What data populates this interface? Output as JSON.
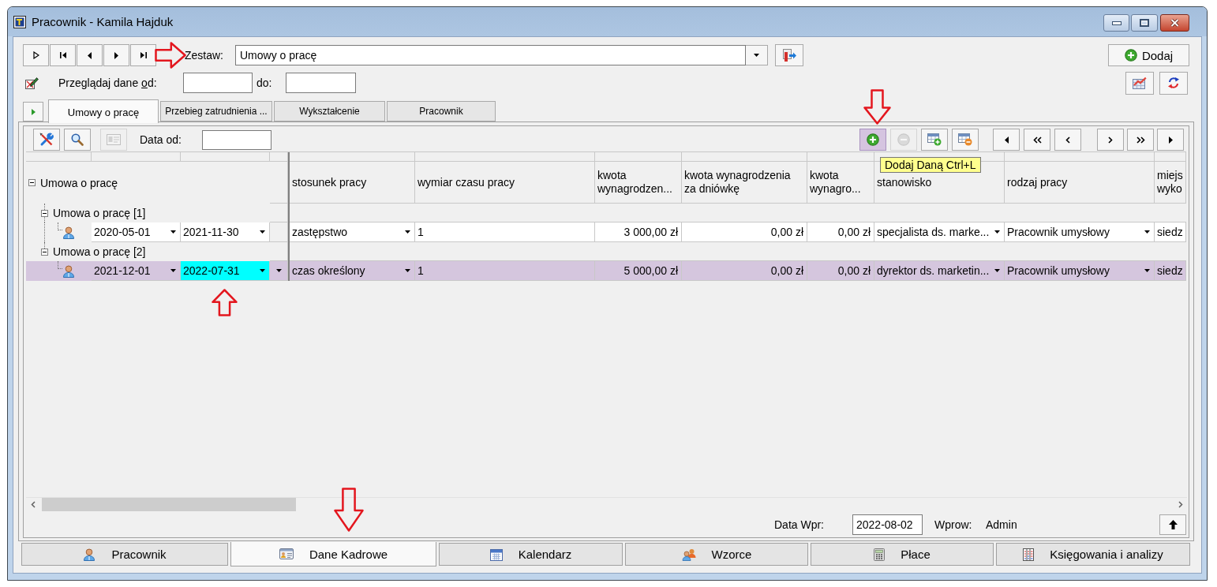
{
  "window": {
    "title": "Pracownik - Kamila Hajduk"
  },
  "toolbar": {
    "set_label": "Zestaw:",
    "set_value": "Umowy o pracę",
    "add_button": "Dodaj"
  },
  "filter": {
    "label_start": "Przeglądaj dane ",
    "label_accesskey": "o",
    "label_end": "d:",
    "to_label": "do:"
  },
  "tabs": [
    {
      "label": "Umowy o pracę",
      "selected": true
    },
    {
      "label": "Przebieg zatrudnienia ...",
      "selected": false
    },
    {
      "label": "Wykształcenie",
      "selected": false
    },
    {
      "label": "Pracownik",
      "selected": false
    }
  ],
  "grid_toolbar": {
    "left_buttons": [
      {
        "disabled": false
      },
      {
        "disabled": false
      },
      {
        "disabled": true
      }
    ],
    "date_label": "Data od:",
    "record_buttons": [
      {
        "disabled": false,
        "hovered": true
      },
      {
        "disabled": true,
        "hovered": false
      },
      {
        "disabled": false,
        "hovered": false
      },
      {
        "disabled": false,
        "hovered": false
      }
    ],
    "tooltip": "Dodaj Daną Ctrl+L"
  },
  "grid": {
    "tree_header": {
      "label": "Umowa o pracę",
      "expanded": true
    },
    "columns": [
      {
        "label": "stosunek pracy",
        "kind": "dropdown"
      },
      {
        "label": "wymiar czasu pracy",
        "kind": "text"
      },
      {
        "label": "kwota wynagrodzen...",
        "kind": "money"
      },
      {
        "label": "kwota wynagrodzenia za dniówkę",
        "kind": "money"
      },
      {
        "label": "kwota wynagro...",
        "kind": "money"
      },
      {
        "label": "stanowisko",
        "kind": "dropdown"
      },
      {
        "label": "rodzaj pracy",
        "kind": "dropdown"
      },
      {
        "label": "miejs wyko",
        "kind": "text"
      }
    ],
    "groups": [
      {
        "label": "Umowa o pracę [1]",
        "expanded": true,
        "rows": [
          {
            "selected": false,
            "dates": [
              {
                "value": "2020-05-01",
                "focused": false
              },
              {
                "value": "2021-11-30",
                "focused": false
              }
            ],
            "cells": [
              "zastępstwo",
              "1",
              "3 000,00 zł",
              "0,00 zł",
              "0,00 zł",
              "specjalista ds. marke...",
              "Pracownik umysłowy",
              "siedz"
            ]
          }
        ]
      },
      {
        "label": "Umowa o pracę [2]",
        "expanded": true,
        "rows": [
          {
            "selected": true,
            "dates": [
              {
                "value": "2021-12-01",
                "focused": false
              },
              {
                "value": "2022-07-31",
                "focused": true
              }
            ],
            "cells": [
              "czas określony",
              "1",
              "5 000,00 zł",
              "0,00 zł",
              "0,00 zł",
              "dyrektor ds. marketin...",
              "Pracownik umysłowy",
              "siedz"
            ]
          }
        ]
      }
    ]
  },
  "footer": {
    "date_label": "Data Wpr:",
    "date_value": "2022-08-02",
    "author_label": "Wprow:",
    "author_value": "Admin"
  },
  "bottom_tabs": [
    {
      "label": "Pracownik",
      "selected": false
    },
    {
      "label": "Dane Kadrowe",
      "selected": true
    },
    {
      "label": "Kalendarz",
      "selected": false
    },
    {
      "label": "Wzorce",
      "selected": false
    },
    {
      "label": "Płace",
      "selected": false
    },
    {
      "label": "Księgowania i analizy",
      "selected": false
    }
  ],
  "annotations": [
    {
      "kind": "right"
    },
    {
      "kind": "down"
    },
    {
      "kind": "up"
    },
    {
      "kind": "down"
    }
  ]
}
